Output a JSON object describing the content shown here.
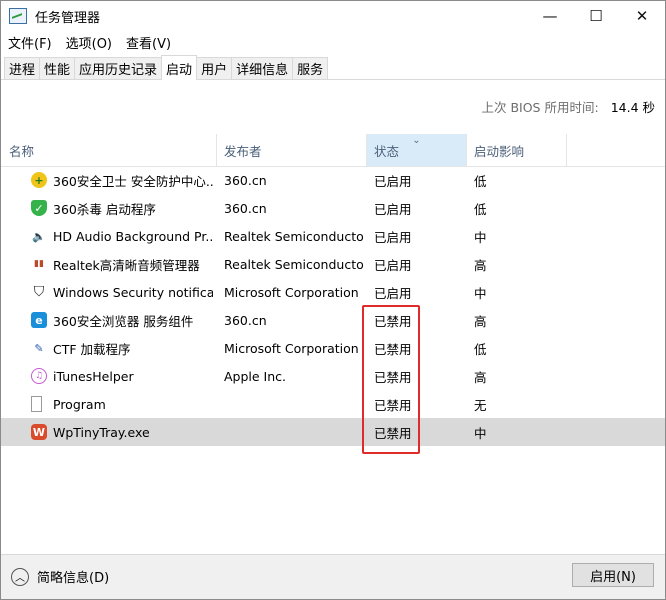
{
  "window": {
    "title": "任务管理器",
    "minimize": "—",
    "maximize": "☐",
    "close": "✕"
  },
  "menu": [
    "文件(F)",
    "选项(O)",
    "查看(V)"
  ],
  "tabs": [
    "进程",
    "性能",
    "应用历史记录",
    "启动",
    "用户",
    "详细信息",
    "服务"
  ],
  "active_tab": "启动",
  "bios": {
    "label": "上次 BIOS 所用时间:",
    "value": "14.4 秒"
  },
  "columns": {
    "name": "名称",
    "publisher": "发布者",
    "status": "状态",
    "impact": "启动影响",
    "sorted": "status"
  },
  "rows": [
    {
      "name": "360安全卫士 安全防护中心...",
      "publisher": "360.cn",
      "status": "已启用",
      "impact": "低",
      "icon": "360-safe-icon"
    },
    {
      "name": "360杀毒 启动程序",
      "publisher": "360.cn",
      "status": "已启用",
      "impact": "低",
      "icon": "360-antivirus-icon"
    },
    {
      "name": "HD Audio Background Pr...",
      "publisher": "Realtek Semiconductor",
      "status": "已启用",
      "impact": "中",
      "icon": "speaker-icon"
    },
    {
      "name": "Realtek高清晰音频管理器",
      "publisher": "Realtek Semiconductor",
      "status": "已启用",
      "impact": "高",
      "icon": "realtek-audio-icon"
    },
    {
      "name": "Windows Security notifica...",
      "publisher": "Microsoft Corporation",
      "status": "已启用",
      "impact": "中",
      "icon": "shield-icon"
    },
    {
      "name": "360安全浏览器 服务组件",
      "publisher": "360.cn",
      "status": "已禁用",
      "impact": "高",
      "icon": "360-browser-icon"
    },
    {
      "name": "CTF 加载程序",
      "publisher": "Microsoft Corporation",
      "status": "已禁用",
      "impact": "低",
      "icon": "ctf-loader-icon"
    },
    {
      "name": "iTunesHelper",
      "publisher": "Apple Inc.",
      "status": "已禁用",
      "impact": "高",
      "icon": "itunes-icon"
    },
    {
      "name": "Program",
      "publisher": "",
      "status": "已禁用",
      "impact": "无",
      "icon": "file-icon"
    },
    {
      "name": "WpTinyTray.exe",
      "publisher": "",
      "status": "已禁用",
      "impact": "中",
      "icon": "wptiny-tray-icon",
      "selected": true
    }
  ],
  "footer": {
    "brief": "简略信息(D)",
    "enable": "启用(N)"
  }
}
